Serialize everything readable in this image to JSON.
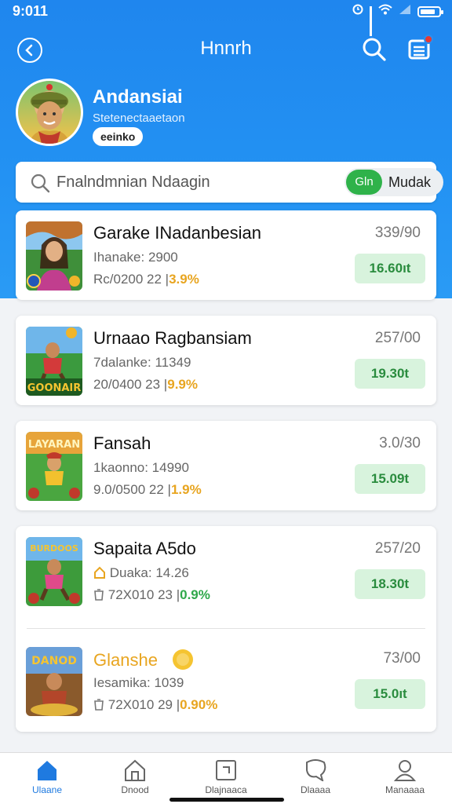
{
  "status_bar": {
    "time": "9:011"
  },
  "header": {
    "title": "Hnnrh"
  },
  "profile": {
    "name": "Andansiai",
    "subtitle": "Stetenectaaetaon",
    "badge": "eeinko"
  },
  "search": {
    "placeholder": "Fnalndmnian Ndaagin",
    "toggle_on": "Gln",
    "toggle_off": "Mudak"
  },
  "items": [
    {
      "title": "Garake INadanbesian",
      "line1": "Ihanake: 2900",
      "line2_prefix": "Rc/0200 22 |",
      "rate": "3.9%",
      "count": "339/90",
      "price": "16.60ıt"
    },
    {
      "title": "Urnaao Ragbansiam",
      "line1": "7dalanke: 11349",
      "line2_prefix": "20/0400 23 |",
      "rate": "9.9%",
      "count": "257/00",
      "price": "19.30t"
    },
    {
      "title": "Fansah",
      "line1": "1kaonno: 14990",
      "line2_prefix": "9.0/0500 22 |",
      "rate": "1.9%",
      "count": "3.0/30",
      "price": "15.09t"
    },
    {
      "title": "Sapaita A5do",
      "line1": "Duaka: 14.26",
      "line2_prefix": "72X010 23 |",
      "rate": "0.9%",
      "count": "257/20",
      "price": "18.30t"
    },
    {
      "title": "Glanshe",
      "line1": "Iesamika: 1039",
      "line2_prefix": "72X010 29 |",
      "rate": "0.90%",
      "count": "73/00",
      "price": "15.0ıt"
    }
  ],
  "tabs": [
    {
      "label": "Ulaane"
    },
    {
      "label": "Dnood"
    },
    {
      "label": "Dlajnaaca"
    },
    {
      "label": "Dlaaaa"
    },
    {
      "label": "Manaaaa"
    }
  ],
  "colors": {
    "primary": "#1f86ee",
    "price_bg": "#d8f3dd",
    "price_text": "#2a8c3e",
    "rate_orange": "#e8a520",
    "rate_green": "#2fa84a",
    "toggle_on": "#2fb24a"
  }
}
